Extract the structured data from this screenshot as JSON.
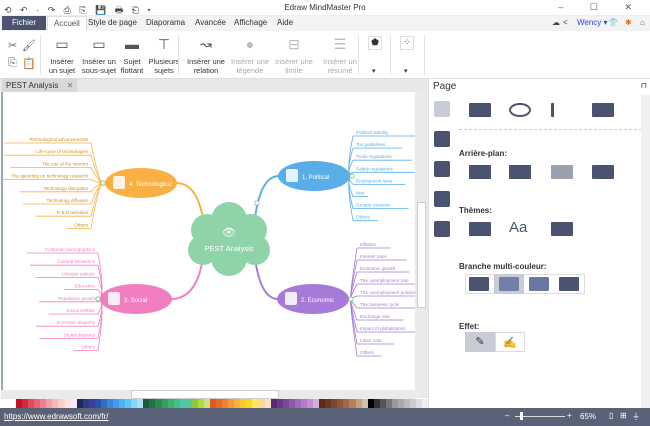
{
  "window": {
    "title": "Edraw MindMaster Pro",
    "quick_access": "⟲ ↶ · ↷ ⎙ ⎘ 💾 🖶 ⎗ ▾",
    "controls": "– ☐ ✕"
  },
  "menu": {
    "tabs": [
      "Fichier",
      "Accueil",
      "Style de page",
      "Diaporama",
      "Avancée",
      "Affichage",
      "Aide"
    ],
    "user": "Wency ▾"
  },
  "ribbon": {
    "buttons": [
      {
        "label": "Insérer un sujet",
        "icon": "insert-topic-icon",
        "enabled": true
      },
      {
        "label": "Insérer un sous-sujet",
        "icon": "insert-subtopic-icon",
        "enabled": true
      },
      {
        "label": "Sujet flottant",
        "icon": "floating-topic-icon",
        "enabled": true
      },
      {
        "label": "Plusieurs sujets",
        "icon": "multiple-topics-icon",
        "enabled": true
      },
      {
        "label": "Insérer une relation",
        "icon": "relation-icon",
        "enabled": true
      },
      {
        "label": "Insérer une légende",
        "icon": "callout-icon",
        "enabled": false
      },
      {
        "label": "Insérer une limite",
        "icon": "boundary-icon",
        "enabled": false
      },
      {
        "label": "Insérer un résumé",
        "icon": "summary-icon",
        "enabled": false
      }
    ]
  },
  "document": {
    "tab": "PEST Analysis"
  },
  "mindmap": {
    "central": "PEST Analysis",
    "branches": [
      {
        "label": "1. Political",
        "color": "#5aaee8",
        "leaves": [
          "Political stability",
          "Tax guidelines",
          "Trade regulations",
          "Safety regulations",
          "Employment laws",
          "War",
          "Groups' pression",
          "Others"
        ]
      },
      {
        "label": "2. Economic",
        "color": "#a57ad8",
        "leaves": [
          "Inflation",
          "Interest rates",
          "Economic growth",
          "The unemployment rate",
          "The unemployment policies",
          "The business cycle",
          "Exchange rate",
          "Impact of globalization",
          "Labor cost",
          "Others"
        ]
      },
      {
        "label": "3. Social",
        "color": "#f17fc0",
        "leaves": [
          "Customer demographics",
          "Cultural limitations",
          "Lifestyle attitude",
          "Education",
          "Population growth",
          "Social welfare",
          "Economic disparity",
          "Digital disparity",
          "Others"
        ]
      },
      {
        "label": "4. Technological",
        "color": "#f9b043",
        "leaves": [
          "Technological advancements",
          "Life-cycle of technologies",
          "The role of the internet",
          "The spending on technology research",
          "Technology disruption",
          "Technology diffusion",
          "R & D activities",
          "Others"
        ]
      }
    ]
  },
  "panel": {
    "title": "Page",
    "sections": {
      "background": "Arrière-plan:",
      "themes": "Thèmes:",
      "rainbow": "Branche multi-couleur:",
      "effect": "Effet:"
    }
  },
  "status": {
    "url": "https://www.edrawsoft.com/fr/",
    "zoom": "65%"
  },
  "palette": [
    "#c0102a",
    "#d42b3c",
    "#e04a5a",
    "#e8637a",
    "#ef7d95",
    "#f1a0a8",
    "#f6b9b9",
    "#fbd0c8",
    "#fde3e5",
    "#f9e9f2",
    "#1b2a5c",
    "#283c8a",
    "#3a3f9c",
    "#2356a8",
    "#2e6dc0",
    "#3b86d8",
    "#3d9de8",
    "#4ab4f0",
    "#5ac8f5",
    "#8ad4f5",
    "#a8e0f8",
    "#1c5a3a",
    "#23704a",
    "#2a8a50",
    "#32a060",
    "#3bb070",
    "#43c08a",
    "#4bc8a8",
    "#56c89a",
    "#8cc840",
    "#b4d840",
    "#cce090",
    "#e05a20",
    "#ea6a28",
    "#f08030",
    "#f59a38",
    "#f8b040",
    "#fac830",
    "#fad820",
    "#fae860",
    "#fad8a0",
    "#f8e4c0",
    "#5a2878",
    "#6a3a8a",
    "#7a4a9a",
    "#8a5aa8",
    "#a06ab8",
    "#b07cc8",
    "#c090d0",
    "#d0b0e0",
    "#5a2a18",
    "#6a3820",
    "#7a4830",
    "#8a5838",
    "#a06848",
    "#b88060",
    "#c8a080",
    "#d0c0a8",
    "#000000",
    "#333333",
    "#555555",
    "#777777",
    "#999999",
    "#aaaaaa",
    "#bbbbbb",
    "#cccccc",
    "#dddddd",
    "#eeeeee"
  ]
}
